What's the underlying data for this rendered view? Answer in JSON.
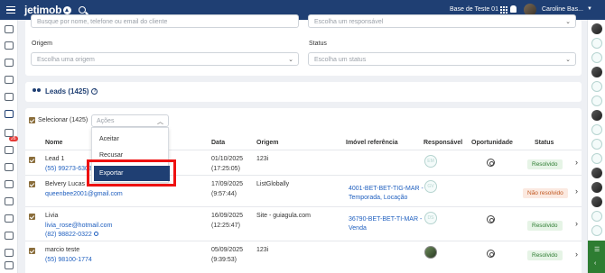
{
  "brand": {
    "name": "jetimob"
  },
  "topbar": {
    "base_label": "Base de Teste 01",
    "user_name": "Caroline Bas..."
  },
  "filters": {
    "search_placeholder": "Busque por nome, telefone ou email do cliente",
    "responsavel_placeholder": "Escolha um responsável",
    "origem_label": "Origem",
    "origem_placeholder": "Escolha uma origem",
    "status_label": "Status",
    "status_placeholder": "Escolha um status"
  },
  "leads": {
    "title": "Leads (1425)",
    "select_all_label": "Selecionar (1425)",
    "actions_placeholder": "Ações",
    "actions_options": [
      "Aceitar",
      "Recusar",
      "Exportar"
    ],
    "selected_option": "Exportar"
  },
  "table": {
    "headers": [
      "Nome",
      "Data",
      "Origem",
      "Imóvel referência",
      "Responsável",
      "Oportunidade",
      "Status"
    ],
    "rows": [
      {
        "name": "Lead 1",
        "contact": "(55) 99273-6308",
        "date": "01/10/2025",
        "time": "(17:25:05)",
        "origin": "123i",
        "property": "",
        "property2": "",
        "responsible": "EM",
        "status": "Resolvido"
      },
      {
        "name": "Belvery Lucas",
        "contact": "queenbee2001@gmail.com",
        "date": "17/09/2025",
        "time": "(9:57:44)",
        "origin": "ListGlobally",
        "property": "4001-BET-BET-TIG-MAR -",
        "property2": "Temporada, Locação",
        "responsible": "GV",
        "status": "Não resolvido"
      },
      {
        "name": "Livia",
        "contact": "livia_rose@hotmail.com",
        "contact2": "(82) 98822-0322",
        "date": "16/09/2025",
        "time": "(12:25:47)",
        "origin": "Site - guiagula.com",
        "property": "36790-BET-BET-TI-MAR -",
        "property2": "Venda",
        "responsible": "DS",
        "status": "Resolvido"
      },
      {
        "name": "marcio teste",
        "contact": "(55) 98100-1774",
        "date": "05/09/2025",
        "time": "(9:39:53)",
        "origin": "123i",
        "property": "",
        "property2": "",
        "responsible": "",
        "status": "Resolvido"
      }
    ]
  },
  "sidebar": {
    "badge": "26"
  },
  "colors": {
    "primary": "#1f3f73",
    "highlight": "#ee1111",
    "resolved": "#2e7d32",
    "unresolved": "#c0561f"
  }
}
